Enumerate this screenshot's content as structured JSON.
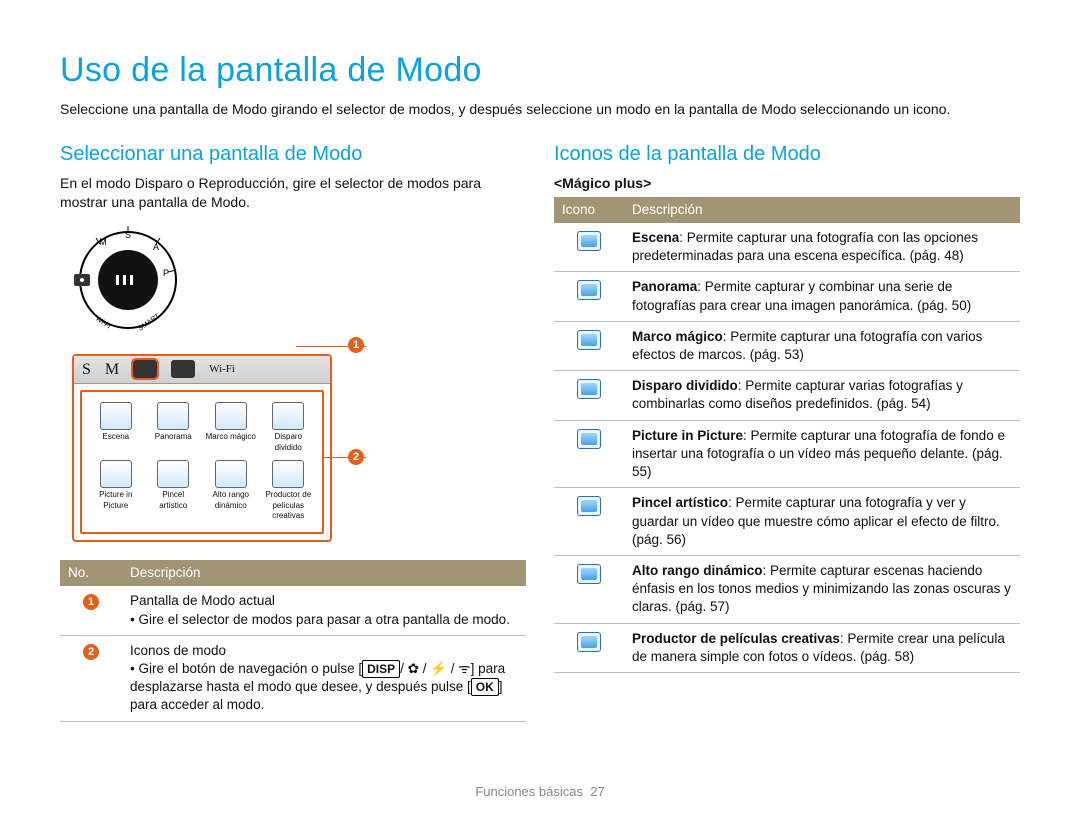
{
  "page_title": "Uso de la pantalla de Modo",
  "intro": "Seleccione una pantalla de Modo girando el selector de modos, y después seleccione un modo en la pantalla de Modo seleccionando un icono.",
  "left": {
    "heading": "Seleccionar una pantalla de Modo",
    "body": "En el modo Disparo o Reproducción, gire el selector de modos para mostrar una pantalla de Modo.",
    "dial_labels": [
      "S",
      "P",
      "A",
      "M",
      "SMART",
      "Wi-Fi"
    ],
    "lcd_top": [
      "S",
      "M",
      "Wi-Fi"
    ],
    "modes": [
      "Escena",
      "Panorama",
      "Marco mágico",
      "Disparo dividido",
      "Picture in Picture",
      "Pincel artístico",
      "Alto rango dinámico",
      "Productor de películas creativas"
    ],
    "callouts": {
      "1": "1",
      "2": "2"
    },
    "table_head": {
      "col1": "No.",
      "col2": "Descripción"
    },
    "rows": [
      {
        "num": "1",
        "title": "Pantalla de Modo actual",
        "bullet": "Gire el selector de modos para pasar a otra pantalla de modo."
      },
      {
        "num": "2",
        "title": "Iconos de modo",
        "bullet_a": "Gire el botón de navegación o pulse [",
        "disp": "DISP",
        "bullet_b": "] para desplazarse hasta el modo que desee, y después pulse [",
        "ok": "OK",
        "bullet_c": "] para acceder al modo.",
        "glyphs": "/ ✿ / ⚡ / ᯤ"
      }
    ]
  },
  "right": {
    "heading": "Iconos de la pantalla de Modo",
    "subhead": "<Mágico plus>",
    "table_head": {
      "col1": "Icono",
      "col2": "Descripción"
    },
    "rows": [
      {
        "name": "Escena",
        "desc": ": Permite capturar una fotografía con las opciones predeterminadas para una escena específica. (pág. 48)"
      },
      {
        "name": "Panorama",
        "desc": ": Permite capturar y combinar una serie de fotografías para crear una imagen panorámica. (pág. 50)"
      },
      {
        "name": "Marco mágico",
        "desc": ": Permite capturar una fotografía con varios efectos de marcos. (pág. 53)"
      },
      {
        "name": "Disparo dividido",
        "desc": ": Permite capturar varias fotografías y combinarlas como diseños predefinidos. (pág. 54)"
      },
      {
        "name": "Picture in Picture",
        "desc": ": Permite capturar una fotografía de fondo e insertar una fotografía o un vídeo más pequeño delante. (pág. 55)"
      },
      {
        "name": "Pincel artístico",
        "desc": ": Permite capturar una fotografía y ver y guardar un vídeo que muestre cómo aplicar el efecto de filtro. (pág. 56)"
      },
      {
        "name": "Alto rango dinámico",
        "desc": ": Permite capturar escenas haciendo énfasis en los tonos medios y minimizando las zonas oscuras y claras. (pág. 57)"
      },
      {
        "name": "Productor de películas creativas",
        "desc": ": Permite crear una película de manera simple con fotos o vídeos. (pág. 58)"
      }
    ]
  },
  "footer": {
    "section": "Funciones básicas",
    "page": "27"
  }
}
